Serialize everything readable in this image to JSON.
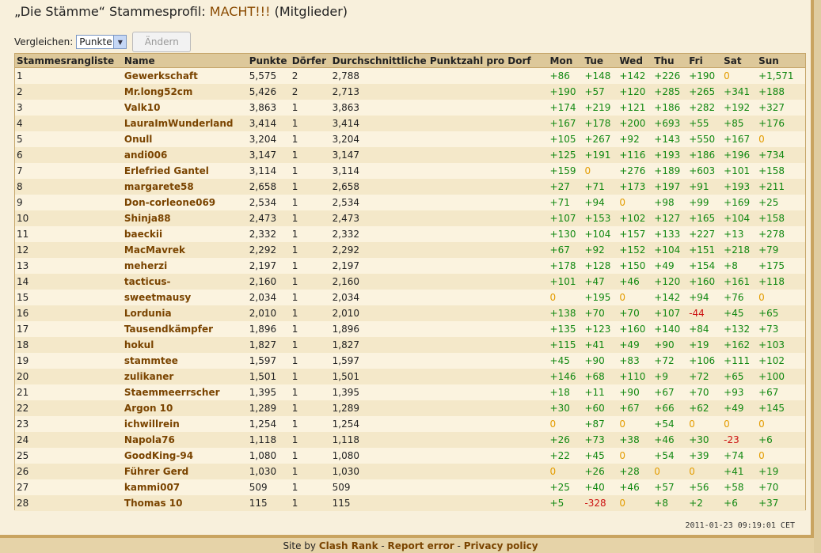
{
  "title": {
    "prefix": "„Die Stämme“ Stammesprofil: ",
    "tribe": "MACHT!!!",
    "suffix": " (Mitglieder)"
  },
  "compare": {
    "label": "Vergleichen:",
    "selected": "Punkte",
    "button": "Ändern"
  },
  "table": {
    "headers": [
      "Stammesrangliste",
      "Name",
      "Punkte",
      "Dörfer",
      "Durchschnittliche Punktzahl pro Dorf",
      "Mon",
      "Tue",
      "Wed",
      "Thu",
      "Fri",
      "Sat",
      "Sun"
    ],
    "rows": [
      [
        "1",
        "Gewerkschaft",
        "5,575",
        "2",
        "2,788",
        "+86",
        "+148",
        "+142",
        "+226",
        "+190",
        "0",
        "+1,571"
      ],
      [
        "2",
        "Mr.long52cm",
        "5,426",
        "2",
        "2,713",
        "+190",
        "+57",
        "+120",
        "+285",
        "+265",
        "+341",
        "+188"
      ],
      [
        "3",
        "Valk10",
        "3,863",
        "1",
        "3,863",
        "+174",
        "+219",
        "+121",
        "+186",
        "+282",
        "+192",
        "+327"
      ],
      [
        "4",
        "LauraImWunderland",
        "3,414",
        "1",
        "3,414",
        "+167",
        "+178",
        "+200",
        "+693",
        "+55",
        "+85",
        "+176"
      ],
      [
        "5",
        "Onull",
        "3,204",
        "1",
        "3,204",
        "+105",
        "+267",
        "+92",
        "+143",
        "+550",
        "+167",
        "0"
      ],
      [
        "6",
        "andi006",
        "3,147",
        "1",
        "3,147",
        "+125",
        "+191",
        "+116",
        "+193",
        "+186",
        "+196",
        "+734"
      ],
      [
        "7",
        "Erlefried Gantel",
        "3,114",
        "1",
        "3,114",
        "+159",
        "0",
        "+276",
        "+189",
        "+603",
        "+101",
        "+158"
      ],
      [
        "8",
        "margarete58",
        "2,658",
        "1",
        "2,658",
        "+27",
        "+71",
        "+173",
        "+197",
        "+91",
        "+193",
        "+211"
      ],
      [
        "9",
        "Don-corleone069",
        "2,534",
        "1",
        "2,534",
        "+71",
        "+94",
        "0",
        "+98",
        "+99",
        "+169",
        "+25"
      ],
      [
        "10",
        "Shinja88",
        "2,473",
        "1",
        "2,473",
        "+107",
        "+153",
        "+102",
        "+127",
        "+165",
        "+104",
        "+158"
      ],
      [
        "11",
        "baeckii",
        "2,332",
        "1",
        "2,332",
        "+130",
        "+104",
        "+157",
        "+133",
        "+227",
        "+13",
        "+278"
      ],
      [
        "12",
        "MacMavrek",
        "2,292",
        "1",
        "2,292",
        "+67",
        "+92",
        "+152",
        "+104",
        "+151",
        "+218",
        "+79"
      ],
      [
        "13",
        "meherzi",
        "2,197",
        "1",
        "2,197",
        "+178",
        "+128",
        "+150",
        "+49",
        "+154",
        "+8",
        "+175"
      ],
      [
        "14",
        "tacticus-",
        "2,160",
        "1",
        "2,160",
        "+101",
        "+47",
        "+46",
        "+120",
        "+160",
        "+161",
        "+118"
      ],
      [
        "15",
        "sweetmausy",
        "2,034",
        "1",
        "2,034",
        "0",
        "+195",
        "0",
        "+142",
        "+94",
        "+76",
        "0"
      ],
      [
        "16",
        "Lordunia",
        "2,010",
        "1",
        "2,010",
        "+138",
        "+70",
        "+70",
        "+107",
        "-44",
        "+45",
        "+65"
      ],
      [
        "17",
        "Tausendkämpfer",
        "1,896",
        "1",
        "1,896",
        "+135",
        "+123",
        "+160",
        "+140",
        "+84",
        "+132",
        "+73"
      ],
      [
        "18",
        "hokul",
        "1,827",
        "1",
        "1,827",
        "+115",
        "+41",
        "+49",
        "+90",
        "+19",
        "+162",
        "+103"
      ],
      [
        "19",
        "stammtee",
        "1,597",
        "1",
        "1,597",
        "+45",
        "+90",
        "+83",
        "+72",
        "+106",
        "+111",
        "+102"
      ],
      [
        "20",
        "zulikaner",
        "1,501",
        "1",
        "1,501",
        "+146",
        "+68",
        "+110",
        "+9",
        "+72",
        "+65",
        "+100"
      ],
      [
        "21",
        "Staemmeerrscher",
        "1,395",
        "1",
        "1,395",
        "+18",
        "+11",
        "+90",
        "+67",
        "+70",
        "+93",
        "+67"
      ],
      [
        "22",
        "Argon 10",
        "1,289",
        "1",
        "1,289",
        "+30",
        "+60",
        "+67",
        "+66",
        "+62",
        "+49",
        "+145"
      ],
      [
        "23",
        "ichwillrein",
        "1,254",
        "1",
        "1,254",
        "0",
        "+87",
        "0",
        "+54",
        "0",
        "0",
        "0"
      ],
      [
        "24",
        "Napola76",
        "1,118",
        "1",
        "1,118",
        "+26",
        "+73",
        "+38",
        "+46",
        "+30",
        "-23",
        "+6"
      ],
      [
        "25",
        "GoodKing-94",
        "1,080",
        "1",
        "1,080",
        "+22",
        "+45",
        "0",
        "+54",
        "+39",
        "+74",
        "0"
      ],
      [
        "26",
        "Führer Gerd",
        "1,030",
        "1",
        "1,030",
        "0",
        "+26",
        "+28",
        "0",
        "0",
        "+41",
        "+19"
      ],
      [
        "27",
        "kammi007",
        "509",
        "1",
        "509",
        "+25",
        "+40",
        "+46",
        "+57",
        "+56",
        "+58",
        "+70"
      ],
      [
        "28",
        "Thomas 10",
        "115",
        "1",
        "115",
        "+5",
        "-328",
        "0",
        "+8",
        "+2",
        "+6",
        "+37"
      ]
    ]
  },
  "timestamp": "2011-01-23 09:19:01 CET",
  "footer": {
    "site_by": "Site by ",
    "clash_rank": "Clash Rank",
    "sep1": " - ",
    "report_error": "Report error",
    "sep2": " - ",
    "privacy_policy": "Privacy policy"
  },
  "colors": {
    "positive": "#118811",
    "negative": "#cc1111",
    "zero": "#e39c00",
    "name": "#7a4400"
  }
}
